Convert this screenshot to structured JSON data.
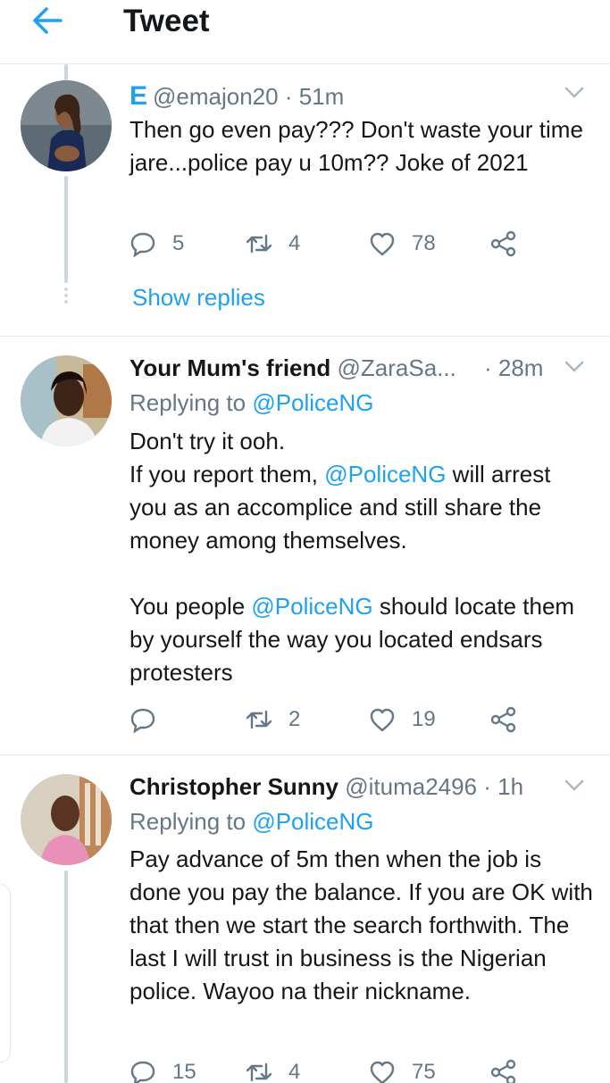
{
  "header": {
    "title": "Tweet"
  },
  "tweets": [
    {
      "name": "",
      "handle": "@emajon20",
      "badge": "E",
      "time": "· 51m",
      "replying_label": "",
      "replying_to": "",
      "body": [
        "Then go even pay??? Don't waste your time jare...police pay u 10m?? Joke of 2021"
      ],
      "replies": "5",
      "retweets": "4",
      "likes": "78",
      "show_replies": "Show replies"
    },
    {
      "name": "Your Mum's friend",
      "handle": "@ZaraSa...",
      "time": "· 28m",
      "replying_label": "Replying to",
      "replying_to": "@PoliceNG",
      "body_lines": {
        "l1": "Don't try it ooh.",
        "l2a": "If you report them, ",
        "l2b": "@PoliceNG",
        "l2c": " will arrest you as an accomplice and still share the money among themselves.",
        "l3a": "You people ",
        "l3b": "@PoliceNG",
        "l3c": " should locate them by yourself the way you located endsars protesters"
      },
      "replies": "",
      "retweets": "2",
      "likes": "19"
    },
    {
      "name": "Christopher Sunny",
      "handle": "@ituma2496",
      "time": "· 1h",
      "replying_label": "Replying to",
      "replying_to": "@PoliceNG",
      "body": [
        "Pay advance of 5m then when the job is done you pay the balance. If you are OK with that then we start the search forthwith. The last I will trust in business is the Nigerian police. Wayoo na their nickname."
      ],
      "replies": "15",
      "retweets": "4",
      "likes": "75"
    }
  ],
  "colors": {
    "accent": "#1da1f2",
    "muted": "#657786",
    "text": "#14171a",
    "divider": "#e1e8ed"
  },
  "icons": [
    "back-arrow-icon",
    "chevron-down-icon",
    "reply-icon",
    "retweet-icon",
    "like-icon",
    "share-icon"
  ]
}
